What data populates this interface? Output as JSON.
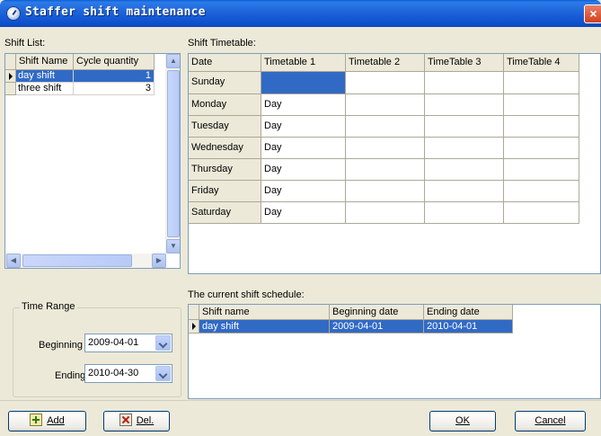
{
  "window": {
    "title": "Staffer shift maintenance",
    "close_label": "×"
  },
  "shift_list": {
    "label": "Shift List:",
    "columns": [
      "Shift Name",
      "Cycle quantity"
    ],
    "rows": [
      {
        "name": "day shift",
        "cycle": "1",
        "selected": true
      },
      {
        "name": "three shift",
        "cycle": "3",
        "selected": false
      }
    ]
  },
  "timetable": {
    "label": "Shift Timetable:",
    "columns": [
      "Date",
      "Timetable 1",
      "Timetable 2",
      "TimeTable 3",
      "TimeTable 4"
    ],
    "rows": [
      {
        "day": "Sunday",
        "t1": ""
      },
      {
        "day": "Monday",
        "t1": "Day"
      },
      {
        "day": "Tuesday",
        "t1": "Day"
      },
      {
        "day": "Wednesday",
        "t1": "Day"
      },
      {
        "day": "Thursday",
        "t1": "Day"
      },
      {
        "day": "Friday",
        "t1": "Day"
      },
      {
        "day": "Saturday",
        "t1": "Day"
      }
    ]
  },
  "time_range": {
    "title": "Time Range",
    "beginning_label": "Beginning",
    "beginning_value": "2009-04-01",
    "ending_label": "Ending",
    "ending_value": "2010-04-30"
  },
  "schedule": {
    "label": "The current shift schedule:",
    "columns": [
      "Shift name",
      "Beginning date",
      "Ending date"
    ],
    "rows": [
      {
        "name": "day shift",
        "begin": "2009-04-01",
        "end": "2010-04-01"
      }
    ]
  },
  "buttons": {
    "add_label": "Add",
    "del_label": "Del.",
    "ok_label": "OK",
    "cancel_label": "Cancel"
  },
  "colors": {
    "selection": "#316AC5",
    "titlebar": "#0C4FCB",
    "dialog_bg": "#ECE9D8"
  }
}
